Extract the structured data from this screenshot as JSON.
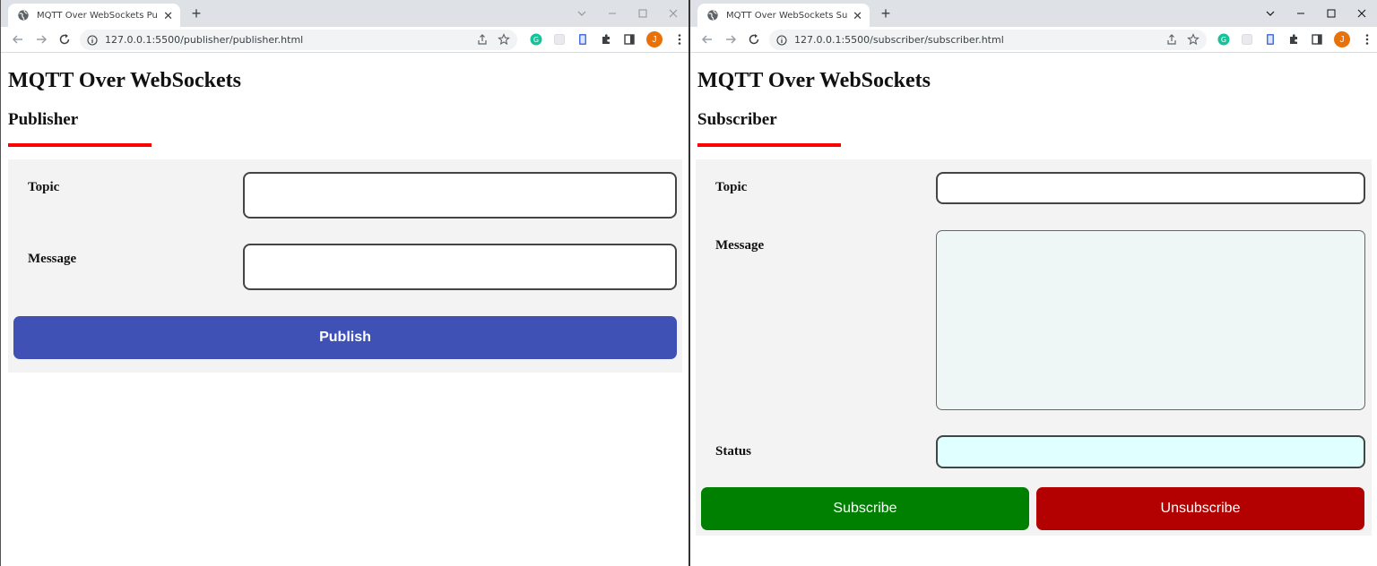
{
  "colors": {
    "publish_button": "#3f51b5",
    "subscribe_button": "#008000",
    "unsubscribe_button": "#b30000",
    "title_underline": "#ff0000",
    "panel_background": "#f4f3f3",
    "message_area_background": "#eef7f6",
    "status_field_background": "#e0ffff"
  },
  "publisher_window": {
    "tab": {
      "title": "MQTT Over WebSockets Publisher",
      "favicon": "globe-icon"
    },
    "address_bar": {
      "url": "127.0.0.1:5500/publisher/publisher.html"
    },
    "page": {
      "title": "MQTT Over WebSockets",
      "subtitle": "Publisher",
      "form": {
        "topic_label": "Topic",
        "topic_value": "",
        "message_label": "Message",
        "message_value": "",
        "publish_label": "Publish"
      }
    }
  },
  "subscriber_window": {
    "tab": {
      "title": "MQTT Over WebSockets Subscriber",
      "favicon": "globe-icon"
    },
    "address_bar": {
      "url": "127.0.0.1:5500/subscriber/subscriber.html"
    },
    "page": {
      "title": "MQTT Over WebSockets",
      "subtitle": "Subscriber",
      "form": {
        "topic_label": "Topic",
        "topic_value": "",
        "message_label": "Message",
        "message_value": "",
        "status_label": "Status",
        "status_value": "",
        "subscribe_label": "Subscribe",
        "unsubscribe_label": "Unsubscribe"
      }
    }
  },
  "toolbar": {
    "avatar_initial": "J"
  }
}
